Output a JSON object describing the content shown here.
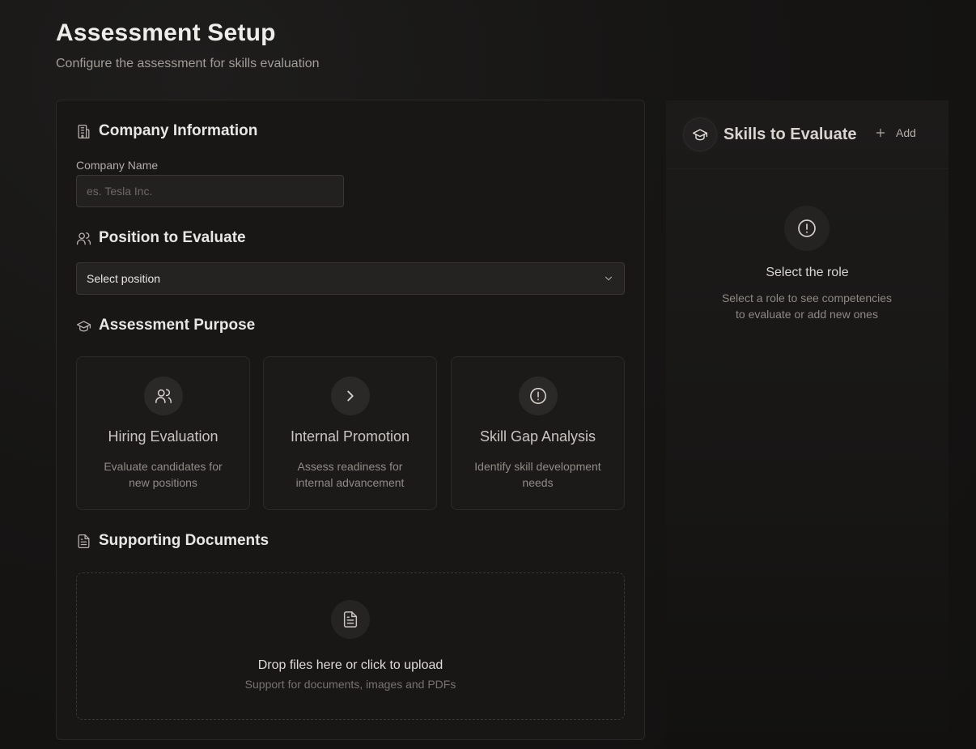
{
  "header": {
    "title": "Assessment Setup",
    "subtitle": "Configure the assessment for skills evaluation"
  },
  "company": {
    "heading": "Company Information",
    "label": "Company Name",
    "placeholder": "es. Tesla Inc.",
    "icon": "building-icon"
  },
  "position": {
    "heading": "Position to Evaluate",
    "selected": "Select position",
    "icon": "users-icon"
  },
  "purpose": {
    "heading": "Assessment Purpose",
    "icon": "graduation-cap-icon",
    "options": [
      {
        "title": "Hiring Evaluation",
        "description": "Evaluate candidates for new positions",
        "icon": "users-icon"
      },
      {
        "title": "Internal Promotion",
        "description": "Assess readiness for internal advancement",
        "icon": "chevron-right-icon"
      },
      {
        "title": "Skill Gap Analysis",
        "description": "Identify skill development needs",
        "icon": "alert-circle-icon"
      }
    ]
  },
  "documents": {
    "heading": "Supporting Documents",
    "icon": "file-text-icon",
    "drop_title": "Drop files here or click to upload",
    "drop_subtitle": "Support for documents, images and PDFs"
  },
  "skills_panel": {
    "title": "Skills to Evaluate",
    "add_label": "Add",
    "empty_title": "Select the role",
    "empty_description": "Select a role to see competencies to evaluate or add new ones"
  },
  "colors": {
    "background": "#141312",
    "card": "#181716",
    "border": "#2a2826",
    "text_primary": "#e8e6e3",
    "text_muted": "#8f8b86"
  }
}
